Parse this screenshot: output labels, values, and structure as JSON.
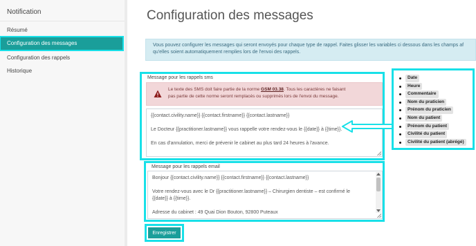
{
  "sidebar": {
    "title": "Notification",
    "items": [
      {
        "label": "Résumé"
      },
      {
        "label": "Configuration des messages"
      },
      {
        "label": "Configuration des rappels"
      },
      {
        "label": "Historique"
      }
    ]
  },
  "main": {
    "title": "Configuration des messages",
    "info_line1": "Vous pouvez configurer les messages qui seront envoyés pour chaque type de rappel. Faites glisser les variables ci dessous dans les champs af",
    "info_line2": "qu'elles soient automatiquement remplies lors de l'envoi des rappels."
  },
  "sms": {
    "label": "Message pour les rappels sms",
    "alert_prefix": "Le texte des SMS doit faire partie de la norme ",
    "alert_norm": "GSM 03.38",
    "alert_suffix": ". Tous les caractères ne faisant",
    "alert_line2": "pas partie de cette norme seront remplacés ou supprimés lors de l'envoi du message.",
    "lines": [
      "{{contact.civility.name}} {{contact.firstname}} {{contact.lastname}}",
      "Le Docteur {{practitioner.lastname}} vous rappelle votre rendez-vous le {{date}} à {{time}}.",
      "En cas d'annulation, merci de prévenir le cabinet au plus tard 24 heures à l'avance."
    ]
  },
  "email": {
    "label": "Message pour les rappels email",
    "lines": [
      "Bonjour {{contact.civility.name}} {{contact.firstname}} {{contact.lastname}}",
      "Votre rendez-vous avec le Dr {{practitioner.lastname}} – Chirurgien dentiste – est confirmé le",
      "{{date}} à {{time}}.",
      "Adresse du cabinet : 49 Quai Dion Bouton, 92800 Puteaux"
    ]
  },
  "variables": [
    "Date",
    "Heure",
    "Commentaire",
    "Nom du praticien",
    "Prénom du praticien",
    "Nom du patient",
    "Prénom du patient",
    "Civilité du patient",
    "Civilité du patient (abrégé)"
  ],
  "save_label": "Enregistrer",
  "colors": {
    "accent": "#1a9e9a",
    "highlight": "#18e0e8",
    "info_bg": "#d5ecf2",
    "alert_bg": "#f2d7d9"
  }
}
